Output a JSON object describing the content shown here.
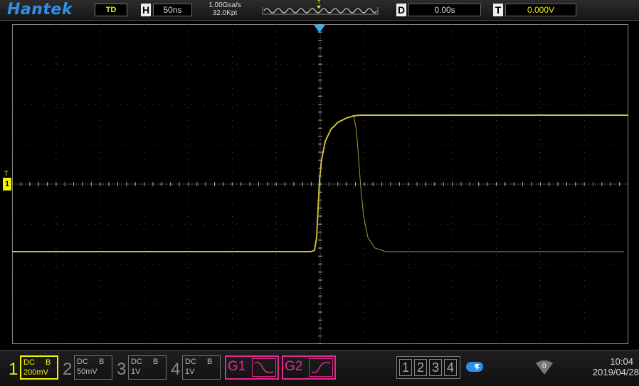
{
  "header": {
    "brand": "Hantek",
    "trigger_mode": "TD",
    "horizontal_letter": "H",
    "timebase": "50ns",
    "sample_rate": "1.00Gsa/s",
    "memory_depth": "32.0Kpt",
    "trigger_marker": "T",
    "delay_letter": "D",
    "delay_value": "0.00s",
    "trigger_letter": "T",
    "trigger_level": "0.000V"
  },
  "screen": {
    "ch1_marker": "1",
    "trigger_level_marker": "T",
    "trace_color": "#c8c040",
    "grid_color": "#5a5a5a"
  },
  "channels": [
    {
      "number": "1",
      "coupling": "DC",
      "bw": "B",
      "scale": "200mV",
      "active": true,
      "color": "#f2f200"
    },
    {
      "number": "2",
      "coupling": "DC",
      "bw": "B",
      "scale": "50mV",
      "active": false,
      "color": "#888888"
    },
    {
      "number": "3",
      "coupling": "DC",
      "bw": "B",
      "scale": "1V",
      "active": false,
      "color": "#888888"
    },
    {
      "number": "4",
      "coupling": "DC",
      "bw": "B",
      "scale": "1V",
      "active": false,
      "color": "#888888"
    }
  ],
  "generators": [
    {
      "label": "G1",
      "wave_icon": "sine-wave-icon",
      "color": "#e02a8e"
    },
    {
      "label": "G2",
      "wave_icon": "sine-wave-icon",
      "color": "#e02a8e"
    }
  ],
  "math_channels": [
    "1",
    "2",
    "3",
    "4"
  ],
  "status": {
    "usb_icon": "usb-icon",
    "wifi_icon": "wifi-icon",
    "wifi_value": "0",
    "time": "10:04",
    "date": "2019/04/28"
  }
}
